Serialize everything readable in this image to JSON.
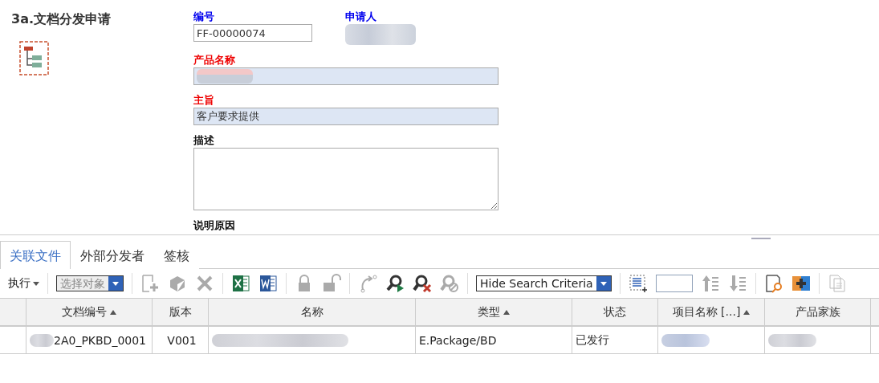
{
  "form": {
    "title": "3a.文档分发申请",
    "fields": [
      {
        "label": "编号",
        "required": false,
        "kind": "input",
        "value": "FF-00000074"
      },
      {
        "label": "申请人",
        "required": false,
        "kind": "person"
      },
      {
        "label": "产品名称",
        "required": true,
        "kind": "wide",
        "redacted": true
      },
      {
        "label": "主旨",
        "required": true,
        "kind": "wide",
        "value": "客户要求提供"
      },
      {
        "label": "描述",
        "required": false,
        "kind": "textarea"
      },
      {
        "label": "说明原因",
        "required": false,
        "kind": "label"
      }
    ]
  },
  "tabs": [
    {
      "label": "关联文件",
      "selected": true
    },
    {
      "label": "外部分发者",
      "selected": false
    },
    {
      "label": "签核",
      "selected": false
    }
  ],
  "toolbar": {
    "action_menu": "执行",
    "object_select": {
      "value": "选择对象",
      "disabled": true
    },
    "search_mode": "Hide Search Criteria"
  },
  "table": {
    "columns": [
      {
        "label": "文档编号",
        "sorted": true
      },
      {
        "label": "版本",
        "sorted": false
      },
      {
        "label": "名称",
        "sorted": false
      },
      {
        "label": "类型",
        "sorted": true
      },
      {
        "label": "状态",
        "sorted": false
      },
      {
        "label": "项目名称 [...]",
        "sorted": true
      },
      {
        "label": "产品家族",
        "sorted": false
      }
    ],
    "rows": [
      {
        "cells": [
          {
            "text": "2A0_PKBD_0001",
            "redacted": true
          },
          {
            "text": "V001"
          },
          {
            "redacted": true
          },
          {
            "text": "E.Package/BD"
          },
          {
            "text": "已发行"
          },
          {
            "redacted": true
          },
          {
            "redacted": true
          }
        ]
      }
    ]
  }
}
